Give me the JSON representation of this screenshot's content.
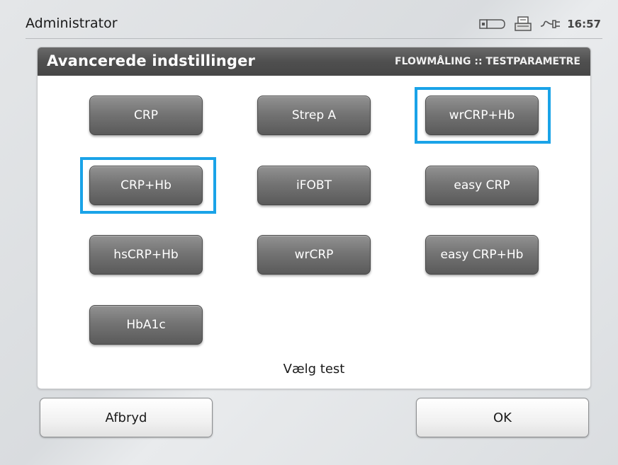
{
  "topbar": {
    "user": "Administrator",
    "time": "16:57",
    "icons": [
      "usb-stick-icon",
      "printer-icon",
      "power-plug-icon"
    ]
  },
  "panel": {
    "title": "Avancerede indstillinger",
    "breadcrumb": "FLOWMÅLING :: TESTPARAMETRE",
    "prompt": "Vælg test"
  },
  "tests": [
    {
      "label": "CRP",
      "selected": false
    },
    {
      "label": "Strep A",
      "selected": false
    },
    {
      "label": "wrCRP+Hb",
      "selected": true
    },
    {
      "label": "CRP+Hb",
      "selected": true
    },
    {
      "label": "iFOBT",
      "selected": false
    },
    {
      "label": "easy CRP",
      "selected": false
    },
    {
      "label": "hsCRP+Hb",
      "selected": false
    },
    {
      "label": "wrCRP",
      "selected": false
    },
    {
      "label": "easy CRP+Hb",
      "selected": false
    },
    {
      "label": "HbA1c",
      "selected": false
    }
  ],
  "actions": {
    "cancel": "Afbryd",
    "ok": "OK"
  },
  "colors": {
    "selection": "#1aa3e8",
    "header": "#555555"
  }
}
